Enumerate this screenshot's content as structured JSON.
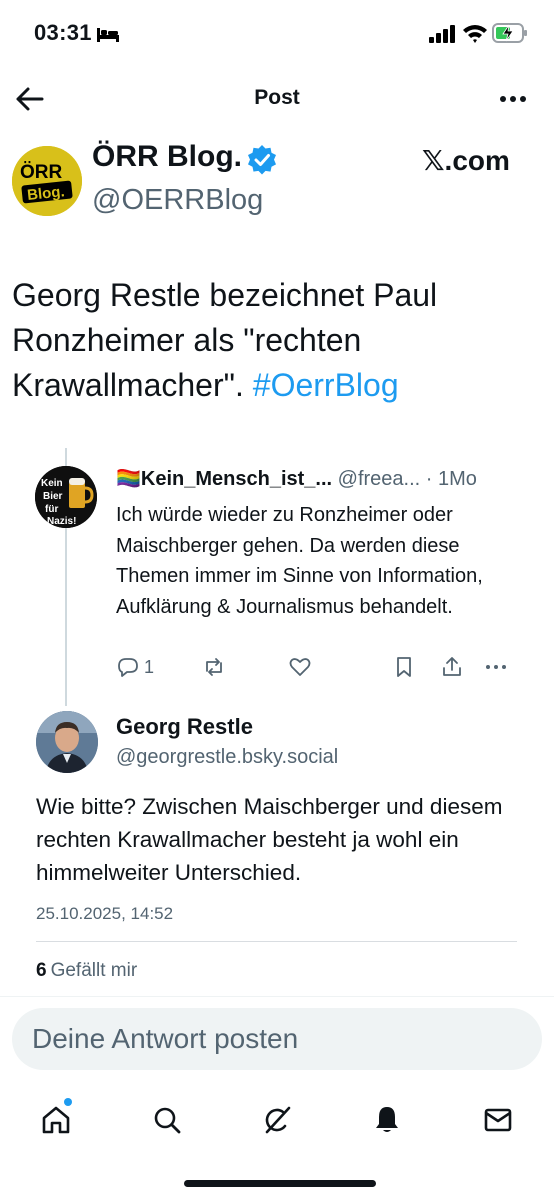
{
  "status_bar": {
    "time": "03:31"
  },
  "header": {
    "title": "Post"
  },
  "author": {
    "name": "ÖRR Blog.",
    "handle": "@OERRBlog",
    "badge_site": "𝕏.com",
    "avatar_text_top": "ÖRR",
    "avatar_text_bottom": "Blog."
  },
  "post": {
    "text": "Georg Restle bezeichnet Paul Ronzheimer als \"rechten Krawallmacher\". ",
    "hashtag": "#OerrBlog"
  },
  "quoted_reply": {
    "name": "🏳️‍🌈Kein_Mensch_ist_...",
    "handle": "@freea...",
    "time": "· 1Mo",
    "avatar_text": [
      "Kein",
      "Bier",
      "für",
      "Nazis!"
    ],
    "body": "Ich würde wieder zu Ronzheimer oder Maischberger gehen. Da werden diese Themen immer im Sinne von Information, Aufklärung & Journalismus behandelt.",
    "reply_count": "1"
  },
  "main_reply": {
    "name": "Georg Restle",
    "handle": "@georgrestle.bsky.social",
    "body": "Wie bitte? Zwischen Maischberger und diesem rechten Krawallmacher besteht ja wohl ein himmelweiter Unterschied.",
    "date": "25.10.2025, 14:52",
    "likes_count": "6",
    "likes_label": "Gefällt mir"
  },
  "composer": {
    "placeholder": "Deine Antwort posten"
  },
  "colors": {
    "accent": "#1d9bf0",
    "secondary_text": "#536471",
    "avatar_yellow": "#d8c01a"
  },
  "nav": {
    "icons": [
      "home-icon",
      "search-icon",
      "grok-icon",
      "notifications-icon",
      "messages-icon"
    ]
  }
}
